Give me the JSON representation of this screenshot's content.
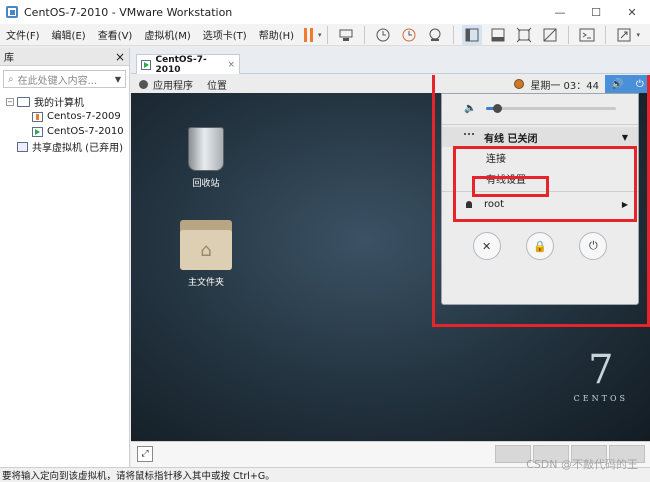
{
  "window": {
    "title": "CentOS-7-2010 - VMware Workstation",
    "controls": [
      "—",
      "☐",
      "✕"
    ]
  },
  "menu": {
    "items": [
      "文件(F)",
      "编辑(E)",
      "查看(V)",
      "虚拟机(M)",
      "选项卡(T)",
      "帮助(H)"
    ]
  },
  "toolbar": {
    "pause_color": "#f07a2e",
    "icons": [
      "send-ctrl-alt-del-icon",
      "snapshot-icon",
      "revert-snapshot-icon",
      "snapshot-manager-icon",
      "library-view-icon",
      "thumbnail-bar-icon",
      "fit-guest-icon",
      "unity-icon",
      "console-icon",
      "fullscreen-icon"
    ]
  },
  "library": {
    "title": "库",
    "close": "×",
    "search_placeholder": "在此处键入内容...",
    "items": [
      {
        "label": "我的计算机",
        "level": 0,
        "expand": "−"
      },
      {
        "label": "Centos-7-2009",
        "level": 1
      },
      {
        "label": "CentOS-7-2010",
        "level": 1
      },
      {
        "label": "共享虚拟机 (已弃用)",
        "level": 0
      }
    ]
  },
  "tab": {
    "label": "CentOS-7-2010",
    "close": "×"
  },
  "guest": {
    "topbar": {
      "apps": "应用程序",
      "places": "位置",
      "clock": "星期一 03：44",
      "volume": "🔊",
      "power": "⏻"
    },
    "desktop": {
      "trash_label": "回收站",
      "home_label": "主文件夹",
      "logo_number": "7",
      "logo_text": "CENTOS"
    },
    "popup": {
      "volume_level": 0.08,
      "network_title": "有线 已关闭",
      "network_arrow": "▼",
      "connect": "连接",
      "wired_settings": "有线设置",
      "user": "root",
      "user_arrow": "▶",
      "buttons": [
        "✕",
        "🔒",
        "⏻"
      ]
    },
    "accent": "#4a90d9"
  },
  "annotations": {
    "color": "#e8242b"
  },
  "status": {
    "text": "要将输入定向到该虚拟机，请将鼠标指针移入其中或按 Ctrl+G。"
  },
  "watermark": "CSDN @不敲代码的王"
}
